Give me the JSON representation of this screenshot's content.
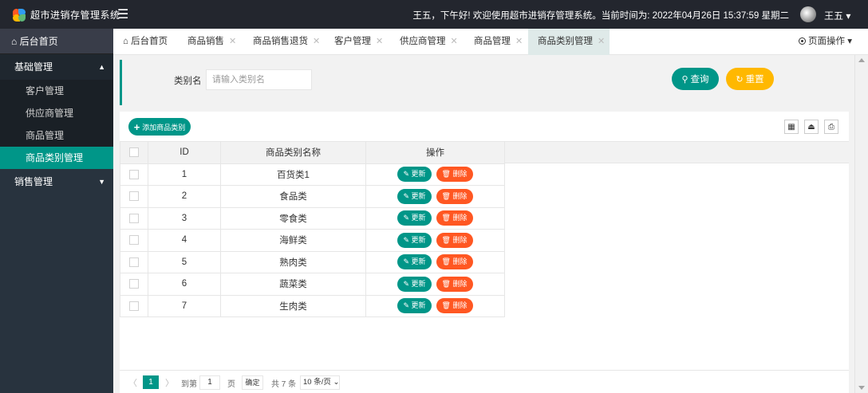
{
  "header": {
    "app_title": "超市进销存管理系统",
    "menu_icon": "hamburger-icon",
    "welcome_text": "王五，下午好! 欢迎使用超市进销存管理系统。当前时间为: 2022年04月26日 15:37:59 星期二",
    "user_name": "王五",
    "user_caret": "▾"
  },
  "sidebar": {
    "home_label": "后台首页",
    "groups": [
      {
        "label": "基础管理",
        "expanded": true,
        "items": [
          {
            "label": "客户管理"
          },
          {
            "label": "供应商管理"
          },
          {
            "label": "商品管理"
          },
          {
            "label": "商品类别管理",
            "active": true
          }
        ]
      },
      {
        "label": "销售管理",
        "expanded": false
      }
    ]
  },
  "tabs": {
    "items": [
      {
        "label": "后台首页"
      },
      {
        "label": "商品销售",
        "close": "✕"
      },
      {
        "label": "商品销售退货",
        "close": "✕"
      },
      {
        "label": "客户管理",
        "close": "✕"
      },
      {
        "label": "供应商管理",
        "close": "✕"
      },
      {
        "label": "商品管理",
        "close": "✕"
      },
      {
        "label": "商品类别管理",
        "close": "✕",
        "active": true
      }
    ],
    "page_ops_label": "页面操作"
  },
  "search": {
    "label": "类别名",
    "placeholder": "请输入类别名",
    "value": "",
    "query_label": "查询",
    "reset_label": "重置"
  },
  "table": {
    "add_label": "添加商品类别",
    "columns": [
      "ID",
      "商品类别名称",
      "操作"
    ],
    "edit_label": "更新",
    "delete_label": "删除",
    "rows": [
      {
        "id": "1",
        "name": "百货类1"
      },
      {
        "id": "2",
        "name": "食品类"
      },
      {
        "id": "3",
        "name": "零食类"
      },
      {
        "id": "4",
        "name": "海鲜类"
      },
      {
        "id": "5",
        "name": "熟肉类"
      },
      {
        "id": "6",
        "name": "蔬菜类"
      },
      {
        "id": "7",
        "name": "生肉类"
      }
    ],
    "toolbar_icons": [
      "columns-filter-icon",
      "export-icon",
      "print-icon"
    ]
  },
  "pager": {
    "prev": "〈",
    "current": "1",
    "next": "〉",
    "goto_label": "到第",
    "goto_value": "1",
    "page_unit": "页",
    "confirm_label": "确定",
    "total_text": "共 7 条",
    "page_size": "10 条/页"
  },
  "colors": {
    "primary": "#009688",
    "warning": "#ffb800",
    "danger": "#ff5722",
    "header_bg": "#23262e",
    "sidebar_bg": "#28333e"
  }
}
